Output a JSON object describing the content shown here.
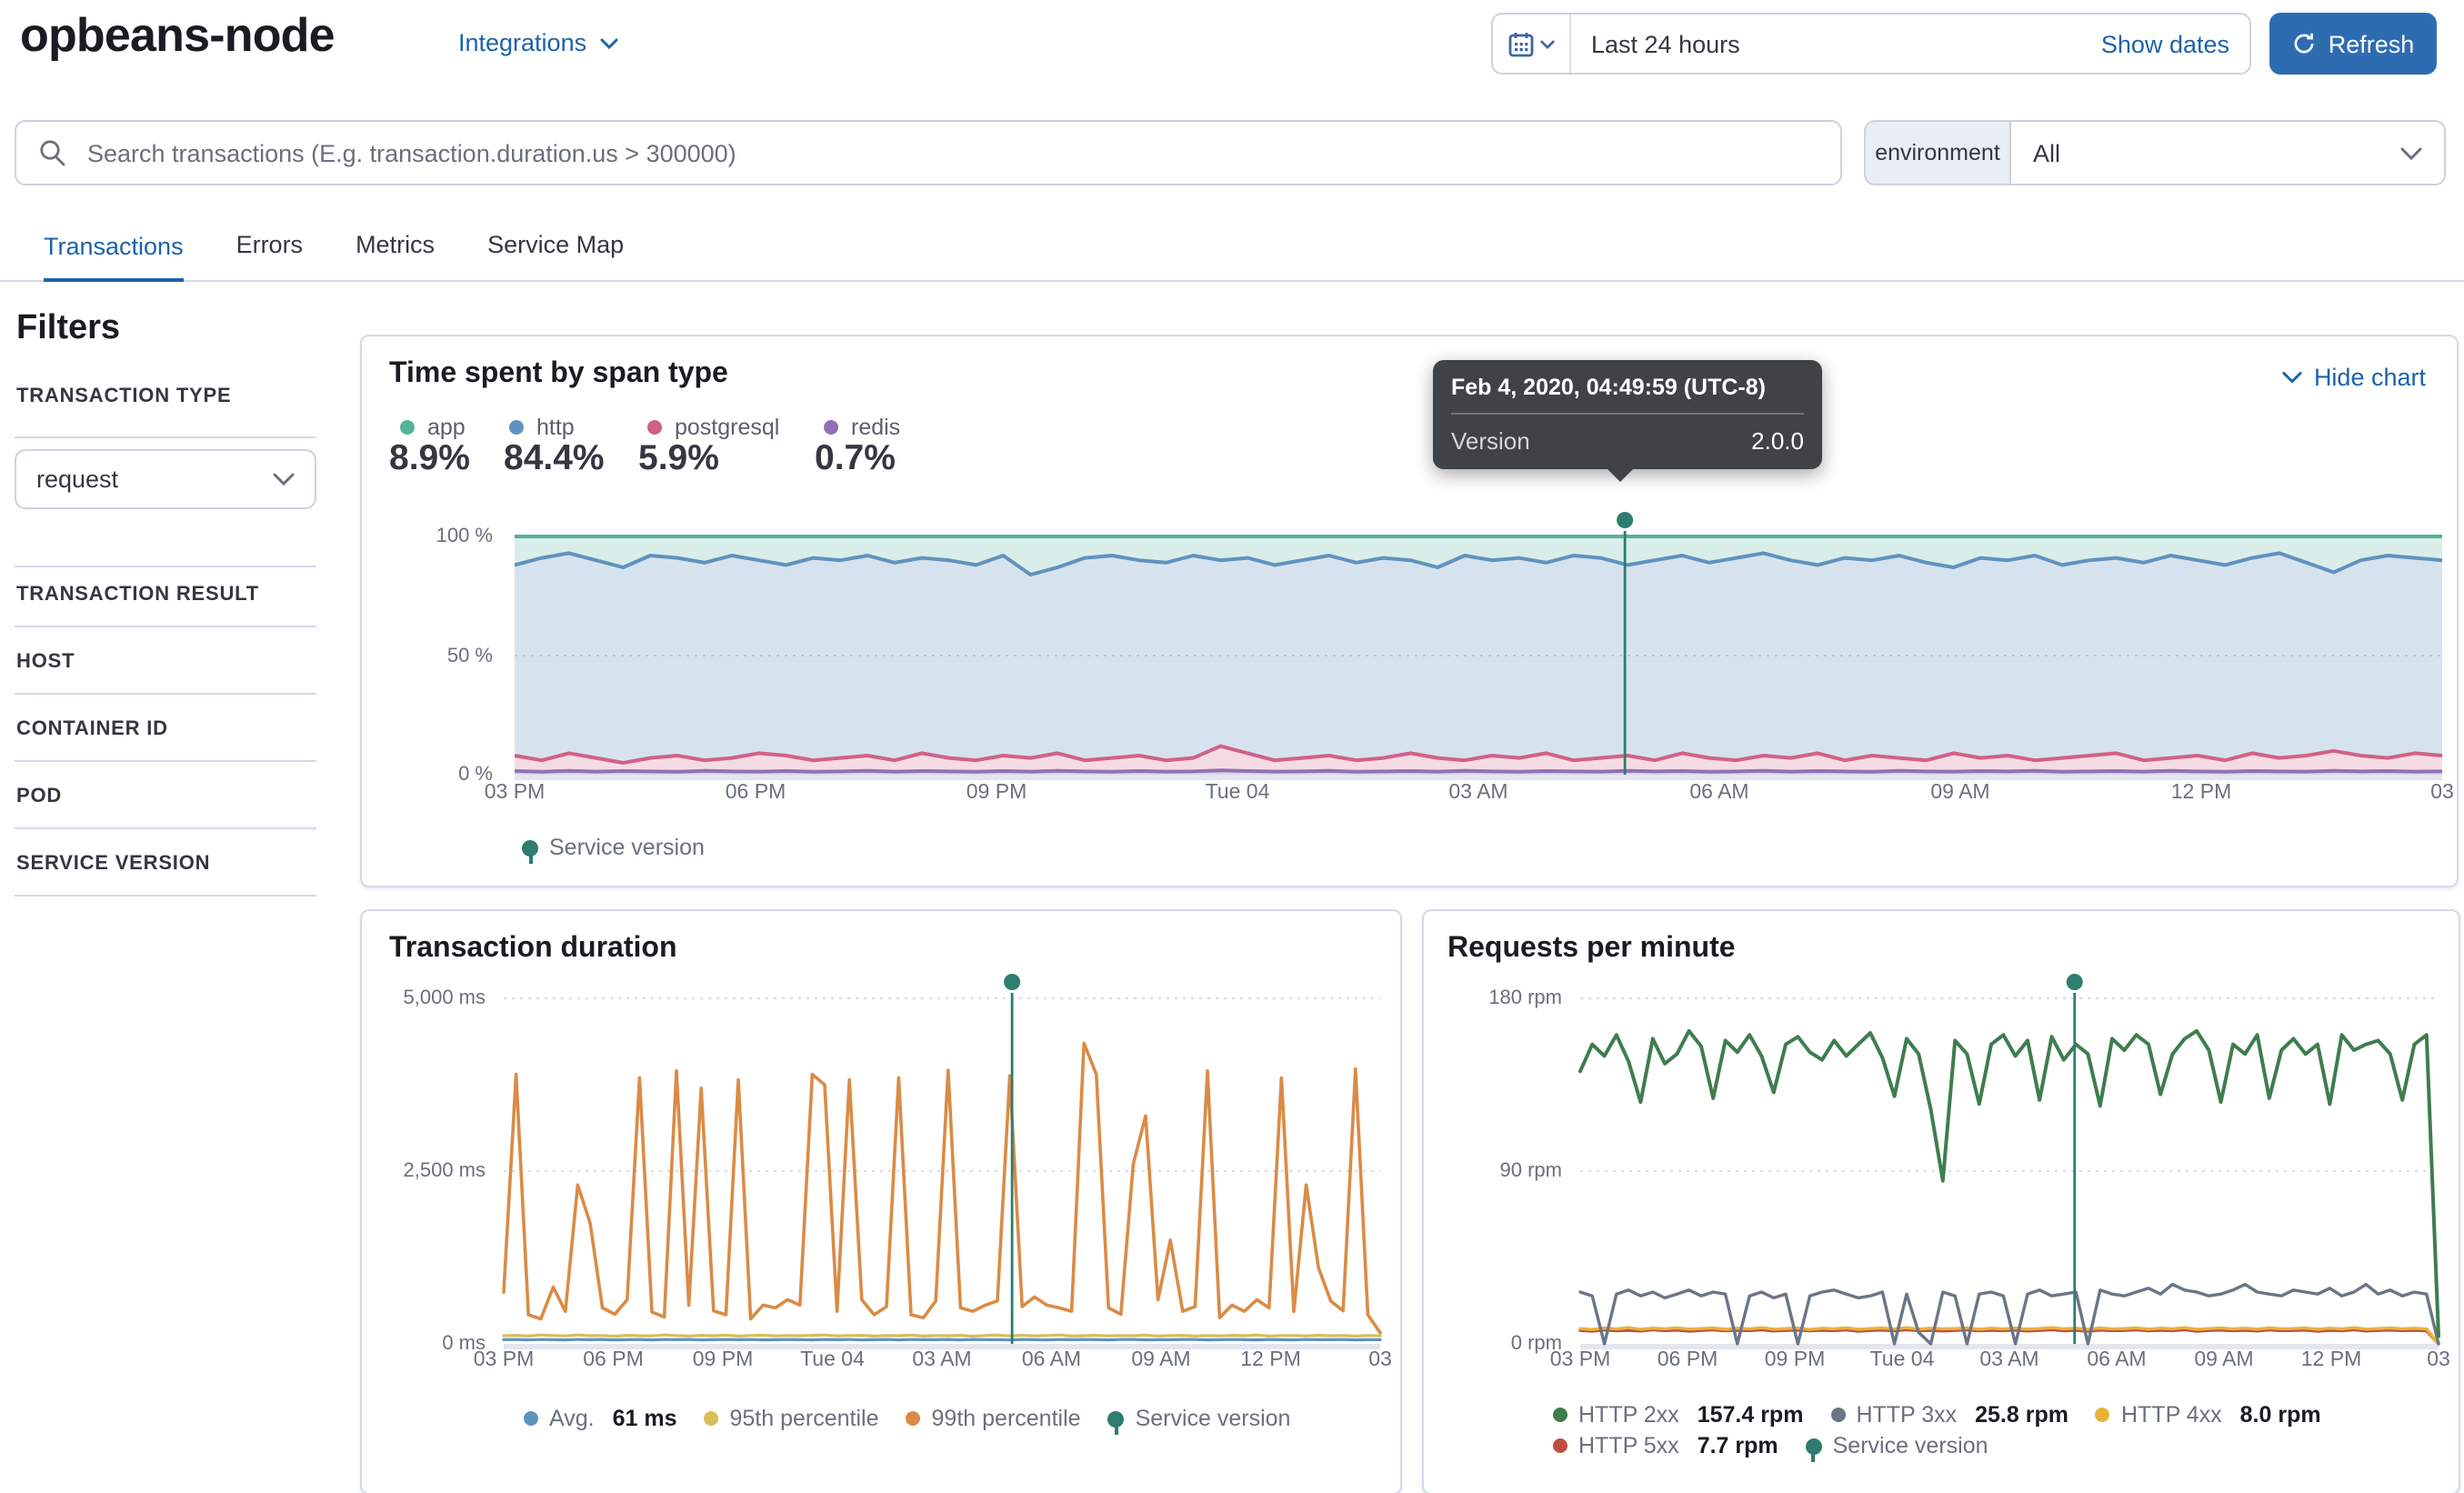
{
  "header": {
    "title": "opbeans-node",
    "integrations_label": "Integrations",
    "time_range": "Last 24 hours",
    "show_dates_label": "Show dates",
    "refresh_label": "Refresh"
  },
  "search": {
    "placeholder": "Search transactions (E.g. transaction.duration.us > 300000)",
    "environment_label": "environment",
    "environment_value": "All"
  },
  "tabs": [
    {
      "label": "Transactions",
      "active": true
    },
    {
      "label": "Errors",
      "active": false
    },
    {
      "label": "Metrics",
      "active": false
    },
    {
      "label": "Service Map",
      "active": false
    }
  ],
  "filters": {
    "heading": "Filters",
    "transaction_type": {
      "label": "TRANSACTION TYPE",
      "value": "request"
    },
    "sections": [
      "TRANSACTION RESULT",
      "HOST",
      "CONTAINER ID",
      "POD",
      "SERVICE VERSION"
    ]
  },
  "links": {
    "hide_chart": "Hide chart"
  },
  "tooltip": {
    "title": "Feb 4, 2020, 04:49:59 (UTC-8)",
    "label": "Version",
    "value": "2.0.0"
  },
  "colors": {
    "accent_blue": "#1c63a8",
    "refresh_button": "#2e6cb2",
    "annotation_teal": "#2e7d6f",
    "tooltip_bg": "#404346"
  },
  "chart_data": [
    {
      "type": "area",
      "stacked_percent": true,
      "title": "Time spent by span type",
      "ylim": [
        0,
        100
      ],
      "y_ticks": [
        "100 %",
        "50 %",
        "0 %"
      ],
      "x_ticks": [
        "03 PM",
        "06 PM",
        "09 PM",
        "Tue 04",
        "03 AM",
        "06 AM",
        "09 AM",
        "12 PM",
        "03"
      ],
      "gridlines": [
        {
          "f": 0.5,
          "dotted": true
        }
      ],
      "annotation": {
        "x_fraction": 0.576,
        "color": "#2e7d6f",
        "label": "Service version"
      },
      "series": [
        {
          "name": "app",
          "pct": "8.9%",
          "color": "#54b399",
          "fill": "rgba(84,179,153,0.22)"
        },
        {
          "name": "http",
          "pct": "84.4%",
          "color": "#6092c0",
          "fill": "rgba(96,146,192,0.26)",
          "values": [
            88,
            91,
            93,
            90,
            87,
            92,
            91,
            89,
            92,
            90,
            88,
            91,
            90,
            92,
            89,
            91,
            90,
            88,
            92,
            84,
            87,
            91,
            92,
            90,
            89,
            92,
            90,
            91,
            88,
            90,
            92,
            89,
            91,
            90,
            87,
            92,
            90,
            91,
            89,
            92,
            91,
            88,
            90,
            92,
            89,
            91,
            93,
            90,
            88,
            91,
            90,
            92,
            89,
            87,
            91,
            90,
            92,
            88,
            90,
            91,
            89,
            92,
            90,
            88,
            91,
            93,
            89,
            85,
            90,
            92,
            91,
            90
          ]
        },
        {
          "name": "postgresql",
          "pct": "5.9%",
          "color": "#d36086",
          "fill": "rgba(211,96,134,0.22)",
          "values": [
            8,
            6,
            9,
            7,
            5,
            7,
            8,
            6,
            7,
            9,
            8,
            6,
            7,
            8,
            6,
            9,
            7,
            6,
            8,
            7,
            9,
            6,
            7,
            8,
            6,
            7,
            12,
            9,
            6,
            7,
            8,
            6,
            7,
            9,
            7,
            6,
            8,
            7,
            9,
            6,
            7,
            8,
            6,
            9,
            7,
            6,
            8,
            7,
            9,
            6,
            8,
            7,
            6,
            9,
            7,
            8,
            6,
            7,
            8,
            9,
            6,
            7,
            8,
            6,
            9,
            7,
            8,
            10,
            8,
            7,
            9,
            8
          ]
        },
        {
          "name": "redis",
          "pct": "0.7%",
          "color": "#9170b8",
          "fill": "rgba(145,112,184,0.30)",
          "values": [
            1.5,
            1.2,
            1.6,
            1.3,
            1.5,
            1.4,
            1.2,
            1.6,
            1.4,
            1.3,
            1.5,
            1.2,
            1.4,
            1.6,
            1.3,
            1.5,
            1.4,
            1.2,
            1.5,
            1.3,
            1.6,
            1.4,
            1.2,
            1.5,
            1.3,
            1.4,
            1.8,
            1.5,
            1.3,
            1.4,
            1.6,
            1.2,
            1.4,
            1.5,
            1.3,
            1.6,
            1.4,
            1.2,
            1.5,
            1.4,
            1.3,
            1.6,
            1.4,
            1.5,
            1.2,
            1.4,
            1.6,
            1.3,
            1.5,
            1.4,
            1.2,
            1.6,
            1.4,
            1.3,
            1.5,
            1.4,
            1.6,
            1.2,
            1.4,
            1.5,
            1.3,
            1.6,
            1.4,
            1.2,
            1.5,
            1.4,
            1.3,
            1.6,
            1.4,
            1.5,
            1.3,
            1.4
          ]
        }
      ]
    },
    {
      "type": "line",
      "title": "Transaction duration",
      "ylim": [
        0,
        5000
      ],
      "y_ticks": [
        "5,000 ms",
        "2,500 ms",
        "0 ms"
      ],
      "x_ticks": [
        "03 PM",
        "06 PM",
        "09 PM",
        "Tue 04",
        "03 AM",
        "06 AM",
        "09 AM",
        "12 PM",
        "03"
      ],
      "gridlines": [
        {
          "f": 0,
          "dotted": true
        },
        {
          "f": 0.5,
          "dotted": true
        }
      ],
      "annotation": {
        "x_fraction": 0.58,
        "color": "#2e7d6f",
        "label": "Service version"
      },
      "series": [
        {
          "name": "Avg.",
          "value_label": "61 ms",
          "color": "#6092c0",
          "z": 2,
          "width": 1.6,
          "values": [
            60,
            62,
            58,
            63,
            61,
            59,
            64,
            60,
            62,
            58,
            61,
            63,
            59,
            62,
            60,
            64,
            58,
            61,
            63,
            60,
            62,
            59,
            61,
            64,
            60,
            58,
            62,
            61,
            63,
            59,
            61,
            62,
            58,
            63,
            60,
            61,
            64,
            59,
            62,
            60,
            61,
            58,
            63,
            61,
            59,
            62,
            60,
            64,
            61,
            58,
            62,
            63,
            59,
            61,
            60,
            62,
            64,
            58,
            61,
            63,
            60,
            59,
            62,
            61,
            58,
            63,
            61,
            60,
            62,
            59,
            61,
            60
          ]
        },
        {
          "name": "95th percentile",
          "color": "#d6bf57",
          "z": 1,
          "width": 1.6,
          "values": [
            118,
            125,
            112,
            130,
            120,
            115,
            128,
            118,
            122,
            110,
            125,
            119,
            116,
            128,
            121,
            114,
            124,
            118,
            126,
            112,
            120,
            127,
            115,
            122,
            118,
            124,
            130,
            116,
            120,
            125,
            113,
            121,
            118,
            127,
            114,
            122,
            119,
            125,
            111,
            120,
            126,
            117,
            123,
            115,
            121,
            128,
            113,
            119,
            124,
            116,
            122,
            118,
            126,
            112,
            120,
            125,
            114,
            121,
            117,
            124,
            119,
            128,
            113,
            120,
            122,
            116,
            125,
            118,
            121,
            114,
            120,
            119
          ]
        },
        {
          "name": "99th percentile",
          "color": "#da8b45",
          "z": 3,
          "width": 1.8,
          "values": [
            750,
            3900,
            420,
            360,
            820,
            470,
            2300,
            1750,
            520,
            430,
            640,
            3850,
            460,
            390,
            3950,
            560,
            3700,
            480,
            420,
            3820,
            360,
            560,
            520,
            640,
            560,
            3900,
            3750,
            470,
            3820,
            640,
            420,
            540,
            3850,
            420,
            380,
            620,
            3960,
            520,
            470,
            560,
            620,
            3880,
            540,
            680,
            560,
            520,
            470,
            4350,
            3900,
            520,
            430,
            2600,
            3300,
            640,
            1500,
            470,
            540,
            3950,
            380,
            560,
            470,
            640,
            520,
            3850,
            470,
            2300,
            1100,
            620,
            480,
            3980,
            420,
            160
          ]
        }
      ]
    },
    {
      "type": "line",
      "title": "Requests per minute",
      "ylim": [
        0,
        180
      ],
      "y_ticks": [
        "180 rpm",
        "90 rpm",
        "0 rpm"
      ],
      "x_ticks": [
        "03 PM",
        "06 PM",
        "09 PM",
        "Tue 04",
        "03 AM",
        "06 AM",
        "09 AM",
        "12 PM",
        "03"
      ],
      "gridlines": [
        {
          "f": 0,
          "dotted": true
        },
        {
          "f": 0.5,
          "dotted": true
        }
      ],
      "annotation": {
        "x_fraction": 0.576,
        "color": "#2e7d6f",
        "label": "Service version"
      },
      "series": [
        {
          "name": "HTTP 2xx",
          "value_label": "157.4 rpm",
          "color": "#3e7d4e",
          "z": 4,
          "width": 2,
          "values": [
            142,
            156,
            150,
            161,
            147,
            126,
            159,
            146,
            151,
            163,
            155,
            128,
            158,
            152,
            161,
            150,
            131,
            156,
            160,
            152,
            148,
            158,
            150,
            156,
            162,
            149,
            129,
            159,
            151,
            122,
            85,
            158,
            151,
            125,
            156,
            161,
            150,
            158,
            127,
            160,
            148,
            156,
            151,
            124,
            159,
            153,
            161,
            156,
            130,
            151,
            159,
            163,
            153,
            126,
            156,
            151,
            161,
            128,
            153,
            159,
            151,
            156,
            125,
            161,
            153,
            156,
            158,
            151,
            127,
            156,
            161,
            4
          ]
        },
        {
          "name": "HTTP 3xx",
          "value_label": "25.8 rpm",
          "color": "#6b7585",
          "z": 3,
          "width": 1.7,
          "values": [
            27,
            25,
            0,
            26,
            28,
            25,
            27,
            24,
            26,
            28,
            25,
            27,
            26,
            0,
            25,
            27,
            24,
            26,
            0,
            25,
            27,
            28,
            26,
            24,
            25,
            27,
            0,
            26,
            6,
            0,
            27,
            25,
            0,
            26,
            27,
            25,
            0,
            26,
            28,
            25,
            26,
            27,
            0,
            28,
            26,
            25,
            27,
            29,
            26,
            31,
            28,
            27,
            25,
            26,
            28,
            31,
            27,
            26,
            25,
            28,
            27,
            26,
            29,
            25,
            27,
            31,
            26,
            28,
            25,
            27,
            26,
            0
          ]
        },
        {
          "name": "HTTP 4xx",
          "value_label": "8.0 rpm",
          "color": "#e8b23a",
          "z": 2,
          "width": 1.7,
          "values": [
            8,
            7.5,
            8.2,
            7.8,
            8.4,
            7.6,
            8.1,
            7.9,
            8.3,
            7.7,
            8,
            8.2,
            7.6,
            8.1,
            7.8,
            8.4,
            7.7,
            8,
            8.2,
            7.5,
            8.1,
            7.9,
            8.3,
            7.6,
            8,
            8.2,
            7.8,
            8.4,
            7.7,
            8.1,
            7.9,
            8,
            8.3,
            7.6,
            8.1,
            7.8,
            8.2,
            7.7,
            8,
            8.4,
            7.9,
            8.1,
            7.6,
            8.2,
            7.8,
            8,
            8.3,
            7.7,
            8.1,
            7.9,
            8.4,
            7.6,
            8,
            8.2,
            7.8,
            8.1,
            7.7,
            8.3,
            7.9,
            8,
            8.2,
            7.6,
            8.1,
            7.8,
            8.4,
            7.7,
            8,
            8.2,
            7.9,
            8.1,
            7.8,
            0
          ]
        },
        {
          "name": "HTTP 5xx",
          "value_label": "7.7 rpm",
          "color": "#bf4e42",
          "z": 1,
          "width": 1.7,
          "values": [
            7,
            6.6,
            7.3,
            6.8,
            7.1,
            6.7,
            7.4,
            6.9,
            7.2,
            6.6,
            7,
            7.3,
            6.8,
            7.1,
            6.9,
            7.4,
            6.7,
            7,
            7.2,
            6.8,
            7.1,
            6.9,
            7.3,
            6.6,
            7,
            7.2,
            6.8,
            7.4,
            6.9,
            7.1,
            6.7,
            7,
            7.3,
            6.8,
            7.1,
            6.9,
            7.2,
            6.7,
            7,
            7.4,
            6.8,
            7.1,
            6.6,
            7.2,
            6.9,
            7,
            7.3,
            6.8,
            7.1,
            6.9,
            7.4,
            6.6,
            7,
            7.2,
            6.8,
            7.1,
            6.7,
            7.3,
            6.9,
            7,
            7.2,
            6.6,
            7.1,
            6.8,
            7.4,
            6.7,
            7,
            7.2,
            6.9,
            7.1,
            6.8,
            0
          ]
        }
      ]
    }
  ]
}
